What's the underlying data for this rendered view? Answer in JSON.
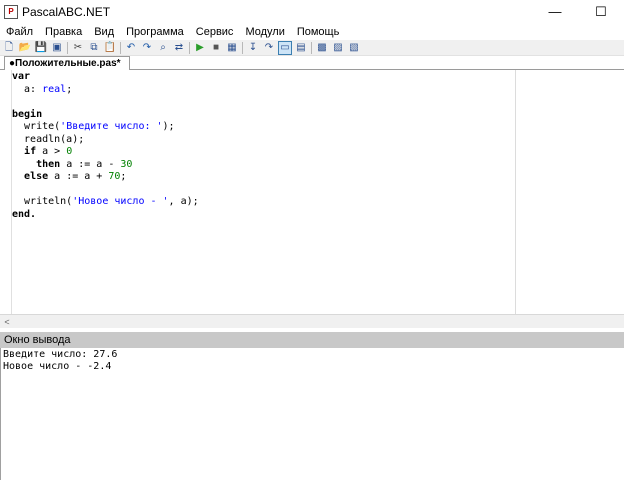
{
  "window": {
    "title": "PascalABC.NET",
    "minimize_glyph": "—",
    "maximize_glyph": "☐",
    "app_icon_glyph": "P"
  },
  "menu": [
    "Файл",
    "Правка",
    "Вид",
    "Программа",
    "Сервис",
    "Модули",
    "Помощь"
  ],
  "toolbar": {
    "groups": [
      [
        "new-file-icon",
        "open-folder-icon",
        "save-icon",
        "save-all-icon"
      ],
      [
        "cut-icon",
        "copy-icon",
        "paste-icon"
      ],
      [
        "undo-icon",
        "redo-icon",
        "find-icon",
        "replace-icon"
      ],
      [
        "run-icon",
        "stop-icon",
        "compile-icon"
      ],
      [
        "step-into-icon",
        "step-over-icon",
        "toggle-output-icon",
        "debug-window-icon"
      ],
      [
        "form-designer-icon",
        "add-form-icon",
        "add-unit-icon"
      ]
    ],
    "active": "toggle-output-icon"
  },
  "tab": {
    "label": "●Положительные.pas*"
  },
  "editor": {
    "lines": [
      [
        {
          "t": "var",
          "c": "kw"
        }
      ],
      [
        {
          "t": "  a: "
        },
        {
          "t": "real",
          "c": "ty"
        },
        {
          "t": ";"
        }
      ],
      [
        {
          "t": ""
        }
      ],
      [
        {
          "t": "begin",
          "c": "kw"
        }
      ],
      [
        {
          "t": "  write("
        },
        {
          "t": "'Введите число: '",
          "c": "st"
        },
        {
          "t": ");"
        }
      ],
      [
        {
          "t": "  readln(a);"
        }
      ],
      [
        {
          "t": "  "
        },
        {
          "t": "if",
          "c": "kw"
        },
        {
          "t": " a > "
        },
        {
          "t": "0",
          "c": "nm"
        }
      ],
      [
        {
          "t": "    "
        },
        {
          "t": "then",
          "c": "kw"
        },
        {
          "t": " a := a - "
        },
        {
          "t": "30",
          "c": "nm"
        }
      ],
      [
        {
          "t": "  "
        },
        {
          "t": "else",
          "c": "kw"
        },
        {
          "t": " a := a + "
        },
        {
          "t": "70",
          "c": "nm"
        },
        {
          "t": ";"
        }
      ],
      [
        {
          "t": ""
        }
      ],
      [
        {
          "t": "  writeln("
        },
        {
          "t": "'Новое число - '",
          "c": "st"
        },
        {
          "t": ", a);"
        }
      ],
      [
        {
          "t": "end.",
          "c": "kw"
        }
      ]
    ]
  },
  "scroll": {
    "left_arrow": "<"
  },
  "output_panel": {
    "title": "Окно вывода",
    "lines": [
      "Введите число: 27.6",
      "Новое число - -2.4"
    ]
  }
}
